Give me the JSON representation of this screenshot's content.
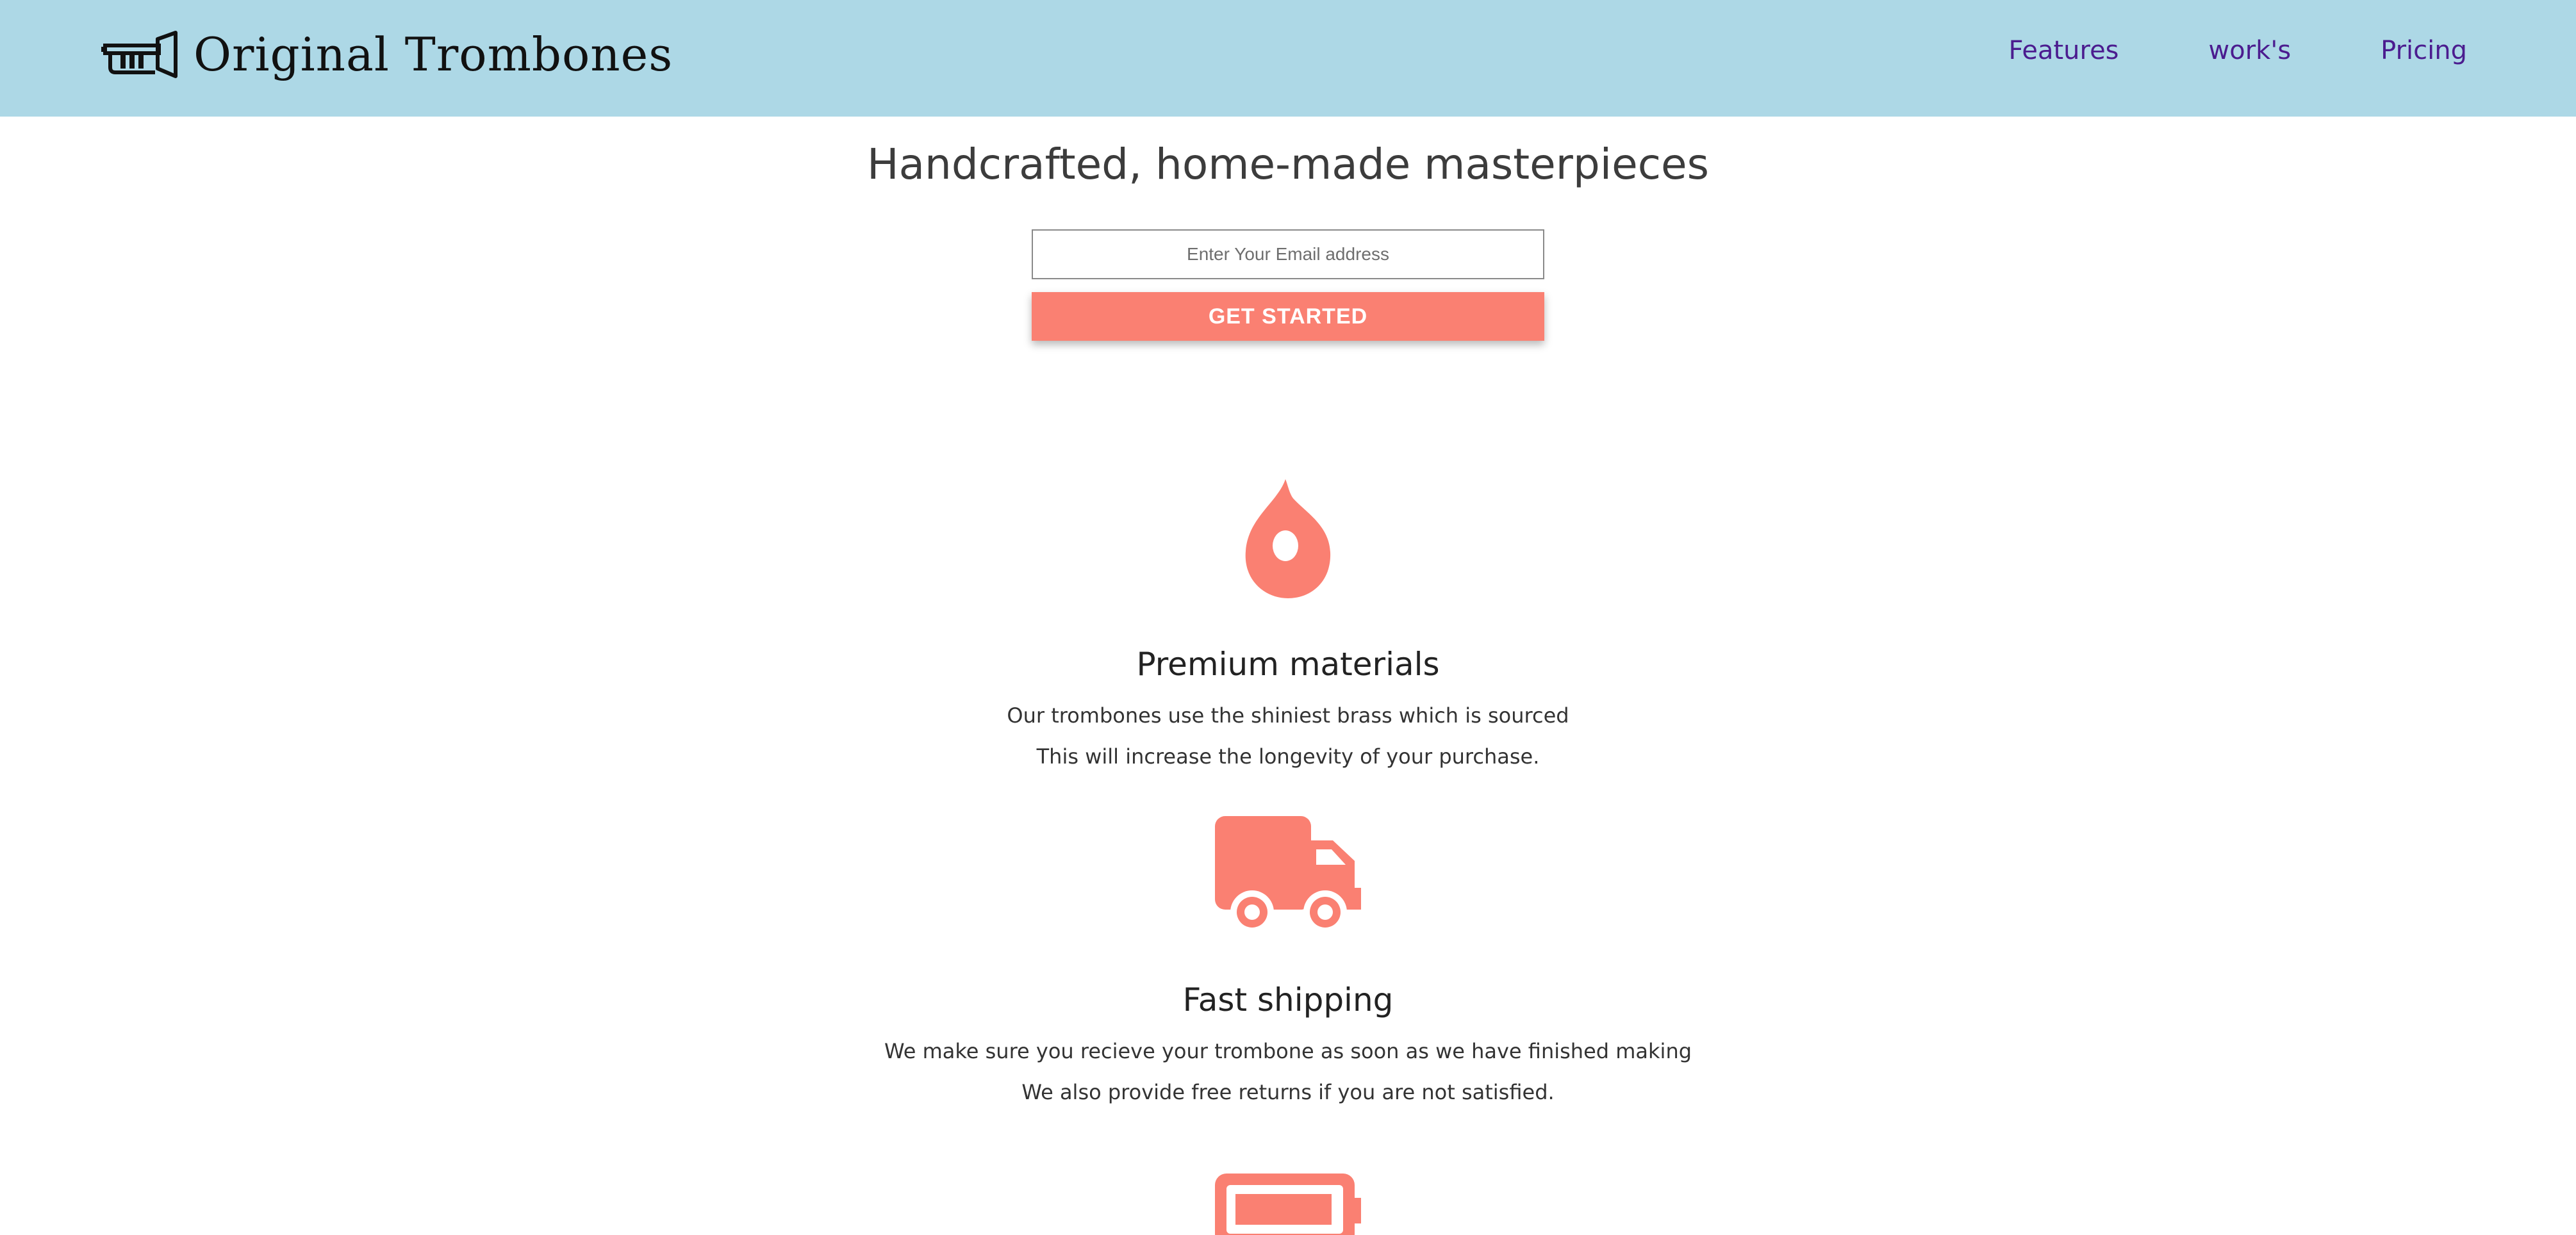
{
  "brand": {
    "name": "Original Trombones",
    "logo_icon": "trumpet-icon"
  },
  "nav": {
    "items": [
      {
        "label": "Features"
      },
      {
        "label": "work's"
      },
      {
        "label": "Pricing"
      }
    ]
  },
  "hero": {
    "title": "Handcrafted, home-made masterpieces",
    "email_placeholder": "Enter Your Email address",
    "cta_label": "GET STARTED"
  },
  "features": [
    {
      "icon": "fire-icon",
      "title": "Premium materials",
      "lines": [
        "Our trombones use the shiniest brass which is sourced",
        "This will increase the longevity of your purchase."
      ]
    },
    {
      "icon": "truck-icon",
      "title": "Fast shipping",
      "lines": [
        "We make sure you recieve your trombone as soon as we have finished making",
        "We also provide free returns if you are not satisfied."
      ]
    },
    {
      "icon": "battery-icon"
    }
  ],
  "colors": {
    "header_bg": "#add8e6",
    "accent": "#fa8072",
    "nav_link": "#4b1c8f"
  }
}
